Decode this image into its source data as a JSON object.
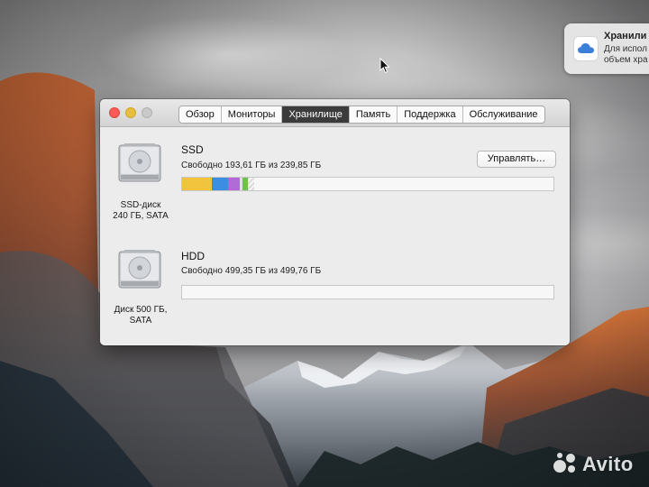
{
  "notification": {
    "title": "Хранили",
    "line1": "Для испол",
    "line2": "объем хра"
  },
  "window": {
    "tabs": [
      {
        "label": "Обзор",
        "active": false
      },
      {
        "label": "Мониторы",
        "active": false
      },
      {
        "label": "Хранилище",
        "active": true
      },
      {
        "label": "Память",
        "active": false
      },
      {
        "label": "Поддержка",
        "active": false
      },
      {
        "label": "Обслуживание",
        "active": false
      }
    ],
    "manage_label": "Управлять…",
    "disks": [
      {
        "name": "SSD",
        "free_text": "Свободно 193,61 ГБ из 239,85 ГБ",
        "label_line1": "SSD-диск",
        "label_line2": "240 ГБ, SATA",
        "usage_segments": [
          {
            "category": "apps",
            "color": "#f2c33c",
            "fraction": 0.08
          },
          {
            "category": "documents",
            "color": "#3b8ee2",
            "fraction": 0.045
          },
          {
            "category": "photos",
            "color": "#b26ad6",
            "fraction": 0.03
          },
          {
            "category": "audio",
            "color": "#e0e0e0",
            "fraction": 0.007
          },
          {
            "category": "other",
            "color": "#6cc24a",
            "fraction": 0.015
          },
          {
            "category": "purgeable",
            "color": "hatched",
            "fraction": 0.018
          }
        ]
      },
      {
        "name": "HDD",
        "free_text": "Свободно 499,35 ГБ из 499,76 ГБ",
        "label_line1": "Диск 500 ГБ,",
        "label_line2": "SATA",
        "usage_segments": []
      }
    ]
  },
  "watermark": {
    "text": "Avito"
  },
  "colors": {
    "active_tab": "#3b3b3b",
    "close": "#fc5b57",
    "minimize": "#e5bf3c"
  }
}
